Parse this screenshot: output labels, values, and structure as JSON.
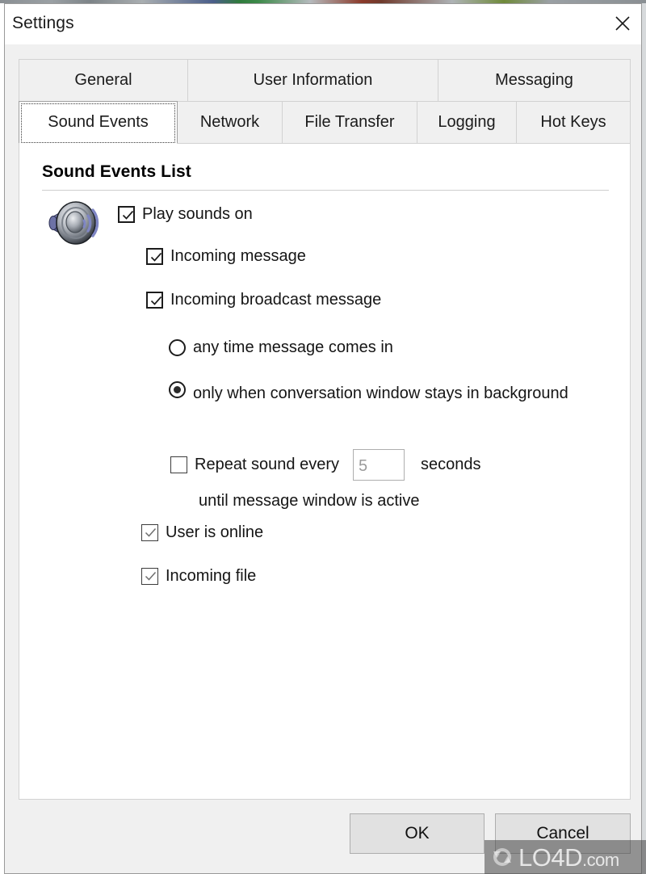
{
  "window": {
    "title": "Settings",
    "close_icon": "close-x-icon"
  },
  "tabs": {
    "row1": [
      {
        "label": "General",
        "selected": false
      },
      {
        "label": "User Information",
        "selected": false
      },
      {
        "label": "Messaging",
        "selected": false
      }
    ],
    "row2": [
      {
        "label": "Sound Events",
        "selected": true
      },
      {
        "label": "Network",
        "selected": false
      },
      {
        "label": "File Transfer",
        "selected": false
      },
      {
        "label": "Logging",
        "selected": false
      },
      {
        "label": "Hot Keys",
        "selected": false
      }
    ]
  },
  "panel": {
    "section_title": "Sound Events List",
    "speaker_icon": "speaker-sound-icon",
    "options": {
      "play_sounds_on": {
        "label": "Play sounds on",
        "checked": true
      },
      "incoming_message": {
        "label": "Incoming message",
        "checked": true
      },
      "incoming_broadcast": {
        "label": "Incoming broadcast message",
        "checked": true
      },
      "any_time": {
        "label": "any time message comes in",
        "selected": false
      },
      "only_background": {
        "label": "only when conversation window stays in background",
        "selected": true
      },
      "repeat_sound": {
        "label": "Repeat sound every",
        "checked": false
      },
      "repeat_seconds_value": "5",
      "repeat_seconds_unit": "seconds",
      "until_active": {
        "label": "until message window is active"
      },
      "user_online": {
        "label": "User is online",
        "checked": true
      },
      "incoming_file": {
        "label": "Incoming file",
        "checked": true
      }
    }
  },
  "buttons": {
    "ok": "OK",
    "cancel": "Cancel"
  },
  "watermark": {
    "text": "LO4D",
    "suffix": ".com",
    "logo_icon": "refresh-circle-icon"
  },
  "colors": {
    "dialog_bg": "#f0f0f0",
    "panel_bg": "#ffffff",
    "text": "#151515",
    "button_bg": "#e1e1e1",
    "border": "#d2d2d2"
  }
}
